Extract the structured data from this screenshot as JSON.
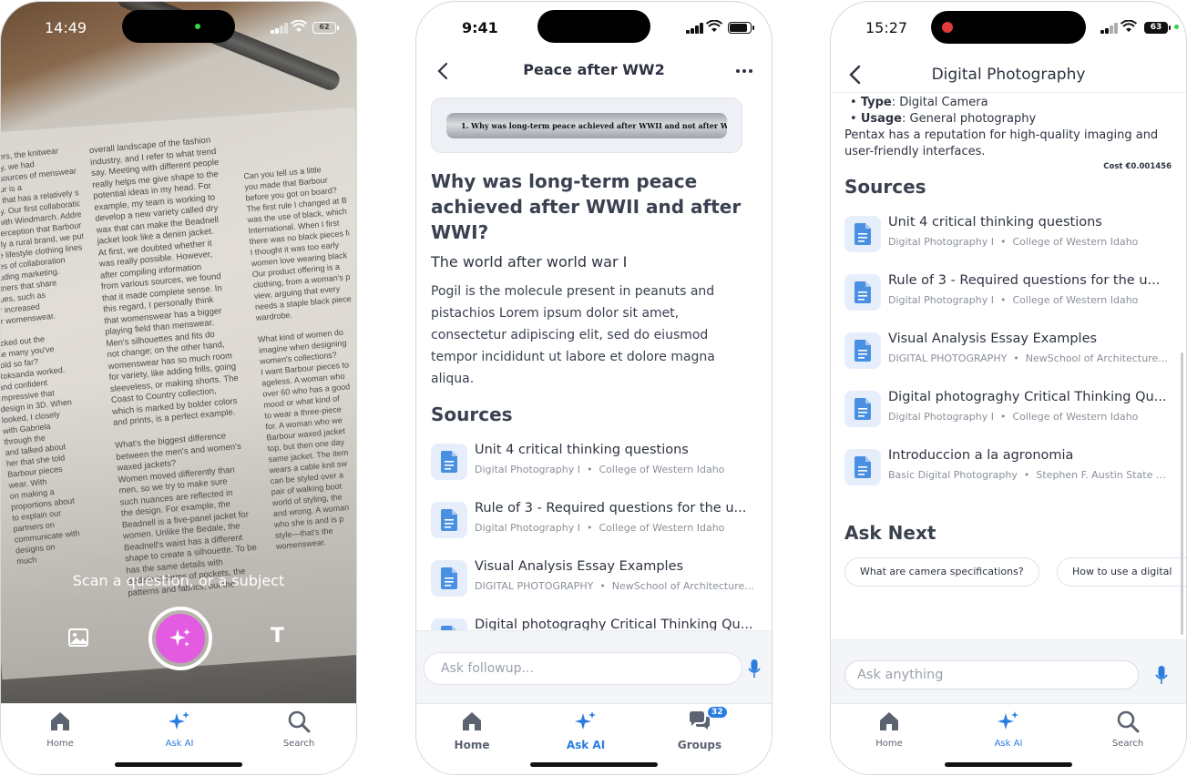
{
  "colors": {
    "accent": "#2b7de0",
    "shutter": "#e35be0",
    "doc_icon": "#4a90e2"
  },
  "phone1": {
    "time": "14:49",
    "battery": "62",
    "scan_prompt": "Scan a question, or a subject",
    "icons": {
      "gallery": "image-icon",
      "shutter": "sparkle-icon",
      "text": "text-icon"
    },
    "book_text": {
      "col1": "shoulders, the knitwear\nindustry, we had\nmany sources of menswear.\nBarbour is a\nbrand that has a relatively short\nhistory. Our first collaboration\nwas with Windmarch. Addressing\nthe perception that Barbour\nis only a rural brand, we put in\nmore lifestyle clothing lines in\nseries of collaboration\nincluding marketing.\npartners that share\nvalues, such as\nour increased\nour womenswear.\n\nlocked out the\nthe many you've\nsold so far?\nRoksanda worked.\nand confident\nimpressive that\ndesign in 3D. When\nlooked, I closely\nwith Gabriela\nthrough the\nand talked about\nher that she told\nBarbour pieces\nwear. With\non making a\nproportions about\nto explain our\npartners on\ncommunicate with\ndesigns on\nmuch\nmore",
      "col2": "overall landscape of the fashion\nindustry, and I refer to what trend\nsay. Meeting with different people\nreally helps me give shape to the\npotential ideas in my head. For\nexample, my team is working to\ndevelop a new variety called dry\nwax that can make the Beadnell\njacket look like a denim jacket.\nAt first, we doubted whether it\nwas really possible. However,\nafter compiling information\nfrom various sources, we found\nthat it made complete sense. In\nthis regard, I personally think\nthat womenswear has a bigger\nplaying field than menswear.\nMen's silhouettes and fits do\nnot change; on the other hand,\nwomenswear has so much room\nfor variety, like adding frills, going\nsleeveless, or making shorts. The\nCoast to Country collection,\nwhich is marked by bolder colors\nand prints, is a perfect example.\n\nWhat's the biggest difference\nbetween the men's and women's\nwaxed jackets?\nWomen moved differently than\nmen, so we try to make sure\nsuch nuances are reflected in\nthe design. For example, the\nBeadnell is a five-panel jacket for\nwomen. Unlike the Bedale, the\nBeadnell's waist has a different\nshape to create a silhouette. To be\nhas the same details with\nBedale in terms of pockets, the\npatterns and fabrics, but the\nrisk of so\nseparate",
      "col3": "Can you tell us a little\nyou made that Barbour\nbefore you got on board?\nThe first rule I changed at Barbour\nwas the use of black, which\nInternational. When I first\nthere was no black pieces for\nI thought it was too early\nwomen love wearing black\nOur product offering is a\nclothing, from a woman's p\nview, arguing that every\nneeds a staple black piece\nwardrobe.\n\nWhat kind of women do\nimagine when designing\nwomen's collections?\nI want Barbour pieces to\nageless. A woman who\nover 60 who has a good\nmood or what kind of\nto wear a three-piece\nfor. A woman who we\nBarbour waxed jacket\ntop, but then one day\nsame jacket. The item\nwears a cable knit sw\ncan be styled over a\npair of walking boot\nworld of styling, the\nand wrong. A woman\nwho she is and is p\nstyle—that's the\nwomenswear."
    }
  },
  "phone2": {
    "time": "9:41",
    "nav_title": "Peace after WW2",
    "scan_thumb_text": "1.  Why was long-term peace achieved after WWII and not after WWI?",
    "question": "Why was long-term peace achieved after WWII and after WWI?",
    "subheading": "The world after world war I",
    "answer": "Pogil is the molecule present in peanuts and pistachios Lorem ipsum dolor sit amet, consectetur adipiscing elit, sed do eiusmod tempor incididunt ut labore et dolore magna aliqua.",
    "sources_title": "Sources",
    "sources": [
      {
        "name": "Unit 4 critical thinking questions",
        "course": "Digital Photography I",
        "school": "College of Western Idaho"
      },
      {
        "name": "Rule of 3 - Required questions for the u...",
        "course": "Digital Photography I",
        "school": "College of Western Idaho"
      },
      {
        "name": "Visual Analysis Essay Examples",
        "course": "DIGITAL PHOTOGRAPHY",
        "school": "NewSchool of Architecture..."
      },
      {
        "name": "Digital photograghy Critical Thinking Qu...",
        "course": "",
        "school": ""
      }
    ],
    "ask_placeholder": "Ask followup...",
    "tabs": [
      {
        "label": "Home"
      },
      {
        "label": "Ask AI"
      },
      {
        "label": "Groups",
        "badge": "32"
      }
    ]
  },
  "phone3": {
    "time": "15:27",
    "battery": "63",
    "nav_title": "Digital Photography",
    "details": [
      {
        "label": "Type",
        "value": ": Digital Camera"
      },
      {
        "label": "Usage",
        "value": ": General photography"
      }
    ],
    "summary": "Pentax has a reputation for high-quality imaging and user-friendly interfaces.",
    "cost": "Cost €0.001456",
    "sources_title": "Sources",
    "sources": [
      {
        "name": "Unit 4 critical thinking questions",
        "course": "Digital Photography I",
        "school": "College of Western Idaho"
      },
      {
        "name": "Rule of 3 - Required questions for the u...",
        "course": "Digital Photography I",
        "school": "College of Western Idaho"
      },
      {
        "name": "Visual Analysis Essay Examples",
        "course": "DIGITAL PHOTOGRAPHY",
        "school": "NewSchool of Architecture..."
      },
      {
        "name": "Digital photograghy Critical Thinking Qu...",
        "course": "Digital Photography I",
        "school": "College of Western Idaho"
      },
      {
        "name": "Introduccion a la agronomia",
        "course": "Basic Digital Photography",
        "school": "Stephen F. Austin State Un..."
      }
    ],
    "ask_next_title": "Ask Next",
    "chips": [
      "What are camera specifications?",
      "How to use a digital"
    ],
    "ask_placeholder": "Ask anything"
  },
  "tabbar_small": [
    {
      "label": "Home"
    },
    {
      "label": "Ask AI"
    },
    {
      "label": "Search"
    }
  ]
}
